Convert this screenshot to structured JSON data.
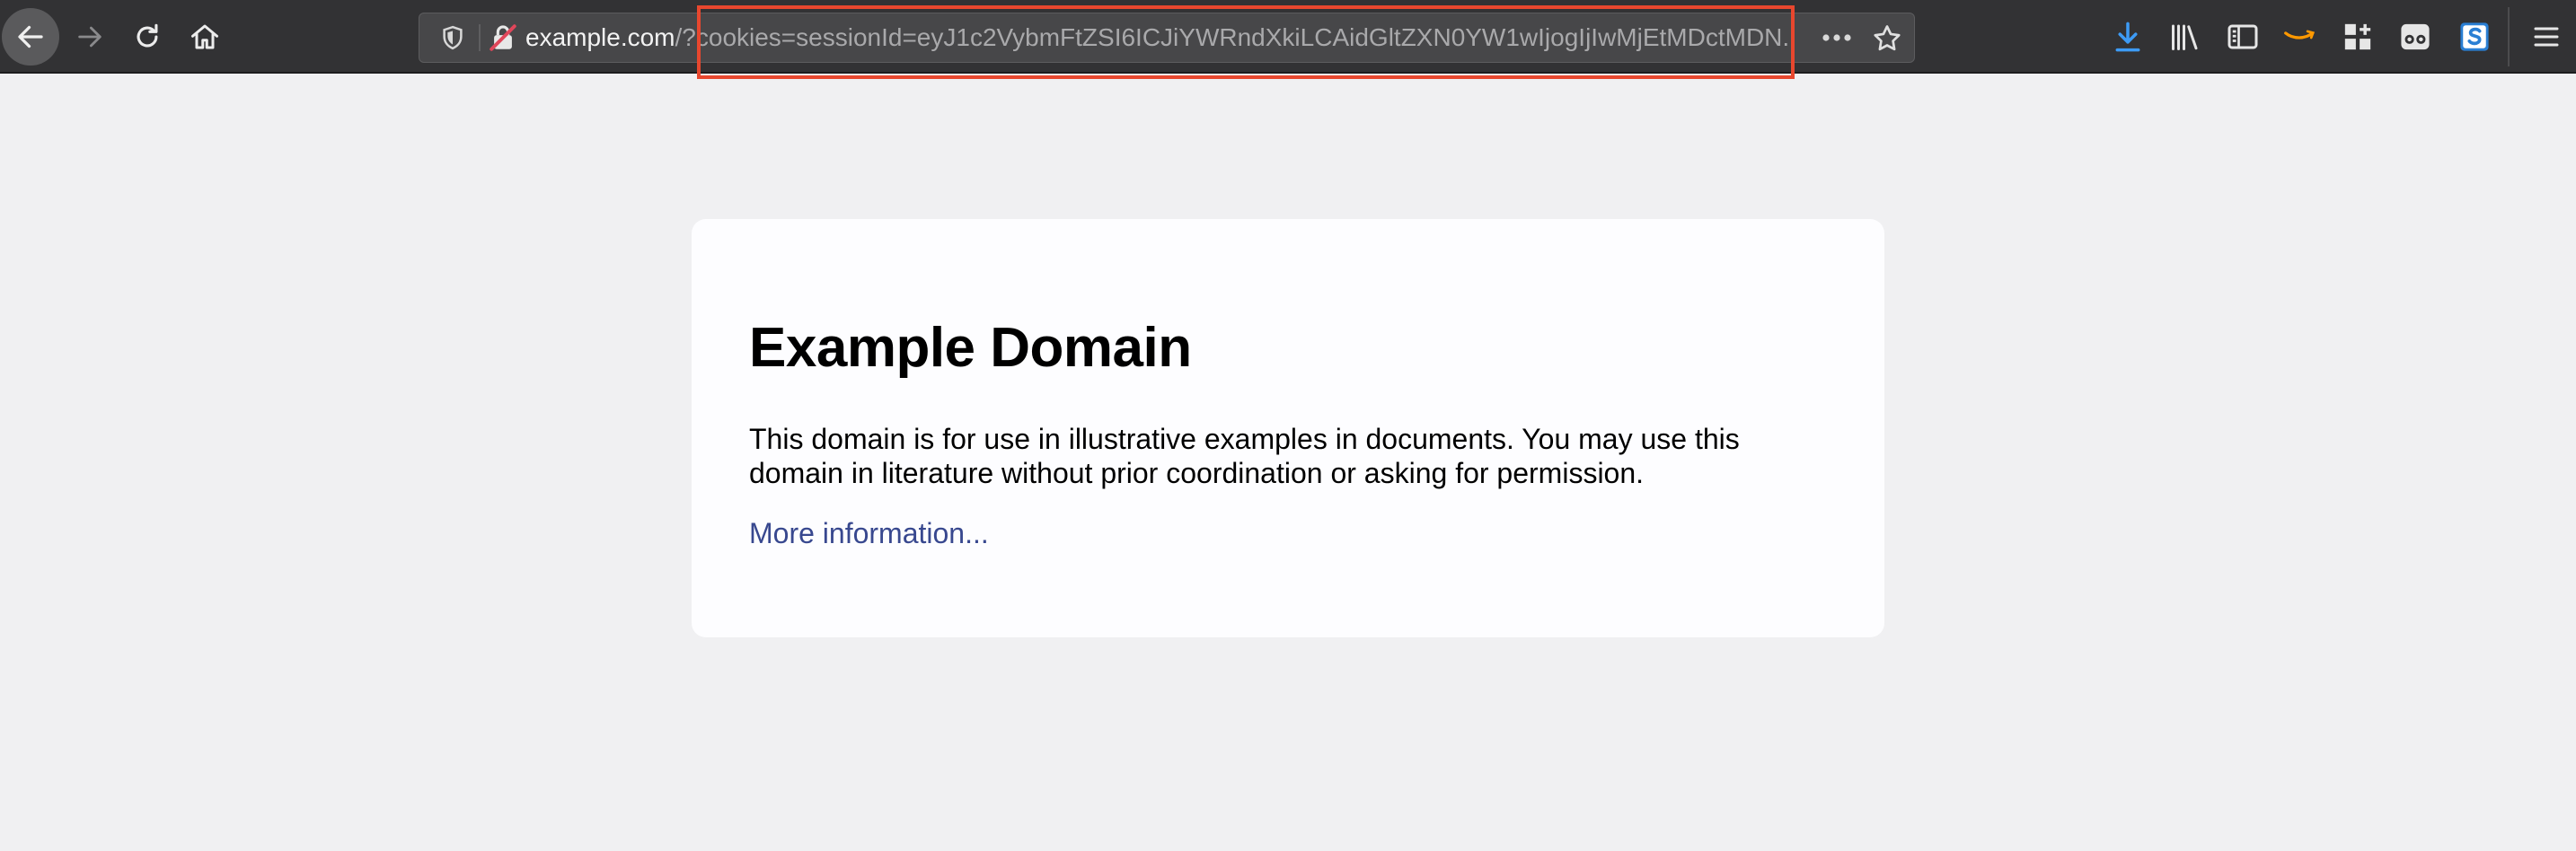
{
  "browser": {
    "url": {
      "domain": "example.com",
      "path": "/?cookies=sessionId=eyJ1c2VybmFtZSI6ICJiYWRndXkiLCAidGltZXN0YW1wIjogIjIwMjEtMDctMDN..."
    },
    "icons": {
      "back": "back-arrow-icon",
      "forward": "forward-arrow-icon",
      "reload": "reload-icon",
      "home": "home-icon",
      "shield": "tracking-protection-shield-icon",
      "insecure": "insecure-connection-icon",
      "more": "page-actions-more-icon",
      "bookmark": "bookmark-star-icon",
      "downloads": "downloads-icon",
      "library": "library-icon",
      "sidebar": "sidebar-icon",
      "amazon": "amazon-extension-icon",
      "extensions": "extensions-grid-icon",
      "reader": "glasses-extension-icon",
      "s-ext": "s-extension-icon",
      "menu": "hamburger-menu-icon"
    },
    "colors": {
      "highlight": "#e8472e",
      "downloads_accent": "#3d9bf5",
      "link": "#38488f"
    }
  },
  "page": {
    "heading": "Example Domain",
    "description": "This domain is for use in illustrative examples in documents. You may use this domain in literature without prior coordination or asking for permission.",
    "link_text": "More information..."
  }
}
